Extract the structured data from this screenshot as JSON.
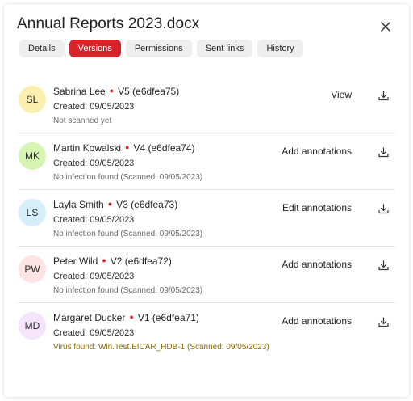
{
  "dialog": {
    "title": "Annual Reports 2023.docx",
    "close_icon": "close-icon"
  },
  "tabs": [
    {
      "label": "Details",
      "active": false
    },
    {
      "label": "Versions",
      "active": true
    },
    {
      "label": "Permissions",
      "active": false
    },
    {
      "label": "Sent links",
      "active": false
    },
    {
      "label": "History",
      "active": false
    }
  ],
  "colors": {
    "accent": "#d8232a",
    "virus_text": "#8a6d00"
  },
  "versions": [
    {
      "initials": "SL",
      "avatar_color": "#fbefb0",
      "name": "Sabrina Lee",
      "version": "V5 (e6dfea75)",
      "created": "Created: 09/05/2023",
      "scan": "Not scanned yet",
      "scan_status": "pending",
      "action": "View",
      "download_icon": "download-icon"
    },
    {
      "initials": "MK",
      "avatar_color": "#d7f5b2",
      "name": "Martin Kowalski",
      "version": "V4 (e6dfea74)",
      "created": "Created: 09/05/2023",
      "scan": "No infection found (Scanned: 09/05/2023)",
      "scan_status": "clean",
      "action": "Add annotations",
      "download_icon": "download-icon"
    },
    {
      "initials": "LS",
      "avatar_color": "#d5eefa",
      "name": "Layla Smith",
      "version": "V3 (e6dfea73)",
      "created": "Created: 09/05/2023",
      "scan": "No infection found (Scanned: 09/05/2023)",
      "scan_status": "clean",
      "action": "Edit annotations",
      "download_icon": "download-icon"
    },
    {
      "initials": "PW",
      "avatar_color": "#fde3e3",
      "name": "Peter Wild",
      "version": "V2 (e6dfea72)",
      "created": "Created: 09/05/2023",
      "scan": "No infection found (Scanned: 09/05/2023)",
      "scan_status": "clean",
      "action": "Add annotations",
      "download_icon": "download-icon"
    },
    {
      "initials": "MD",
      "avatar_color": "#f5e4fb",
      "name": "Margaret Ducker",
      "version": "V1 (e6dfea71)",
      "created": "Created: 09/05/2023",
      "scan": "Virus found: Win.Test.EICAR_HDB-1 (Scanned: 09/05/2023)",
      "scan_status": "virus",
      "action": "Add annotations",
      "download_icon": "download-icon"
    }
  ]
}
